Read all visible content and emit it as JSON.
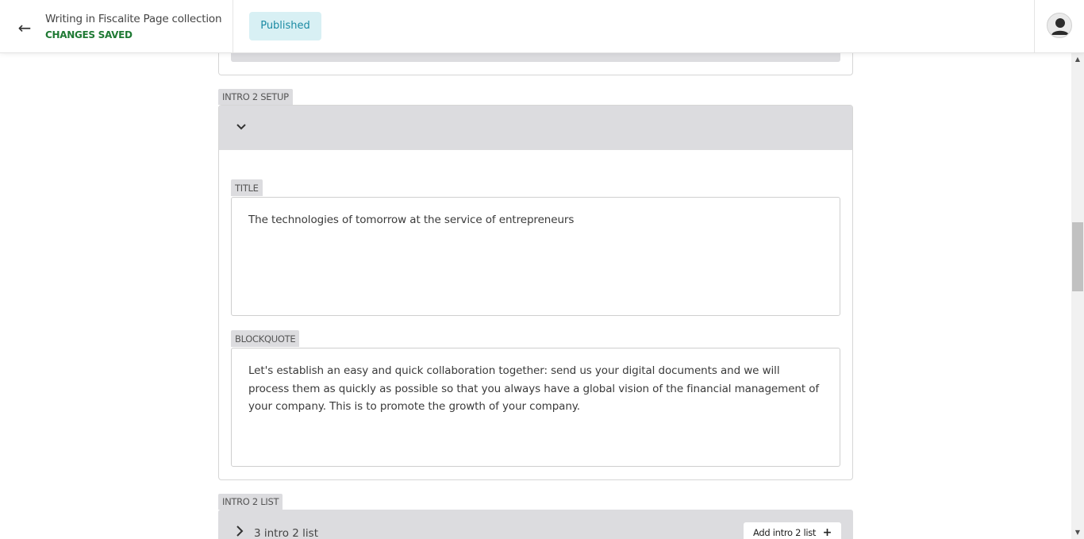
{
  "header": {
    "title": "Writing in Fiscalite Page collection",
    "status": "CHANGES SAVED",
    "published_label": "Published",
    "back_icon": "←"
  },
  "sections": {
    "intro2_setup": {
      "tag": "INTRO 2 SETUP",
      "title_field": {
        "label": "TITLE",
        "value": "The technologies of tomorrow at the service of entrepreneurs"
      },
      "blockquote_field": {
        "label": "BLOCKQUOTE",
        "value": "Let's establish an easy and quick collaboration together: send us your digital documents and we will process them as quickly as possible so that you always have a global vision of the financial management of your company. This is to promote the growth of your company."
      }
    },
    "intro2_list": {
      "tag": "INTRO 2 LIST",
      "summary": "3 intro 2 list",
      "add_label": "Add intro 2 list",
      "add_icon": "+"
    }
  },
  "colors": {
    "status_green": "#1f7a34",
    "badge_bg": "#d8f0f4",
    "badge_text": "#1b8aa3",
    "panel_gray": "#dcdcdf"
  }
}
